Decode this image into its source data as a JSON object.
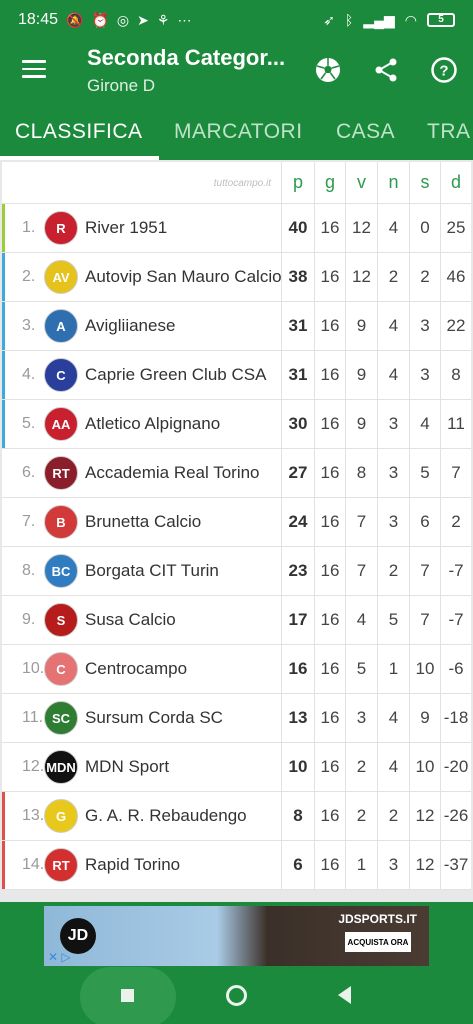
{
  "status_bar": {
    "time": "18:45",
    "battery": "5"
  },
  "app_bar": {
    "title": "Seconda Categor...",
    "subtitle": "Girone D"
  },
  "tabs": [
    {
      "label": "CLASSIFICA",
      "active": true
    },
    {
      "label": "MARCATORI",
      "active": false
    },
    {
      "label": "CASA",
      "active": false
    },
    {
      "label": "TRA",
      "active": false
    }
  ],
  "table": {
    "brand": "tuttocampo.it",
    "columns": [
      "p",
      "g",
      "v",
      "n",
      "s",
      "d"
    ],
    "rows": [
      {
        "pos": "1.",
        "team": "River 1951",
        "p": "40",
        "g": "16",
        "v": "12",
        "n": "4",
        "s": "0",
        "d": "25",
        "zone": "#9bcc3a",
        "logo_color": "#c8202f",
        "logo_text": "R"
      },
      {
        "pos": "2.",
        "team": "Autovip San Mauro Calcio",
        "p": "38",
        "g": "16",
        "v": "12",
        "n": "2",
        "s": "2",
        "d": "46",
        "zone": "#3fa8dc",
        "logo_color": "#e6c21c",
        "logo_text": "AV"
      },
      {
        "pos": "3.",
        "team": "Avigliianese",
        "p": "31",
        "g": "16",
        "v": "9",
        "n": "4",
        "s": "3",
        "d": "22",
        "zone": "#3fa8dc",
        "logo_color": "#2f6fb0",
        "logo_text": "A"
      },
      {
        "pos": "4.",
        "team": "Caprie Green Club CSA",
        "p": "31",
        "g": "16",
        "v": "9",
        "n": "4",
        "s": "3",
        "d": "8",
        "zone": "#3fa8dc",
        "logo_color": "#2a3f9c",
        "logo_text": "C"
      },
      {
        "pos": "5.",
        "team": "Atletico Alpignano",
        "p": "30",
        "g": "16",
        "v": "9",
        "n": "3",
        "s": "4",
        "d": "11",
        "zone": "#3fa8dc",
        "logo_color": "#c8202f",
        "logo_text": "AA"
      },
      {
        "pos": "6.",
        "team": "Accademia Real Torino",
        "p": "27",
        "g": "16",
        "v": "8",
        "n": "3",
        "s": "5",
        "d": "7",
        "zone": "",
        "logo_color": "#8b1e2b",
        "logo_text": "RT"
      },
      {
        "pos": "7.",
        "team": "Brunetta Calcio",
        "p": "24",
        "g": "16",
        "v": "7",
        "n": "3",
        "s": "6",
        "d": "2",
        "zone": "",
        "logo_color": "#d23a3a",
        "logo_text": "B"
      },
      {
        "pos": "8.",
        "team": "Borgata CIT Turin",
        "p": "23",
        "g": "16",
        "v": "7",
        "n": "2",
        "s": "7",
        "d": "-7",
        "zone": "",
        "logo_color": "#2f7cc1",
        "logo_text": "BC"
      },
      {
        "pos": "9.",
        "team": "Susa Calcio",
        "p": "17",
        "g": "16",
        "v": "4",
        "n": "5",
        "s": "7",
        "d": "-7",
        "zone": "",
        "logo_color": "#b71c1c",
        "logo_text": "S"
      },
      {
        "pos": "10.",
        "team": "Centrocampo",
        "p": "16",
        "g": "16",
        "v": "5",
        "n": "1",
        "s": "10",
        "d": "-6",
        "zone": "",
        "logo_color": "#e57373",
        "logo_text": "C"
      },
      {
        "pos": "11.",
        "team": "Sursum Corda SC",
        "p": "13",
        "g": "16",
        "v": "3",
        "n": "4",
        "s": "9",
        "d": "-18",
        "zone": "",
        "logo_color": "#2e7d32",
        "logo_text": "SC"
      },
      {
        "pos": "12.",
        "team": "MDN Sport",
        "p": "10",
        "g": "16",
        "v": "2",
        "n": "4",
        "s": "10",
        "d": "-20",
        "zone": "",
        "logo_color": "#111111",
        "logo_text": "MDN"
      },
      {
        "pos": "13.",
        "team": "G. A. R. Rebaudengo",
        "p": "8",
        "g": "16",
        "v": "2",
        "n": "2",
        "s": "12",
        "d": "-26",
        "zone": "#e0504a",
        "logo_color": "#e8c81a",
        "logo_text": "G"
      },
      {
        "pos": "14.",
        "team": "Rapid Torino",
        "p": "6",
        "g": "16",
        "v": "1",
        "n": "3",
        "s": "12",
        "d": "-37",
        "zone": "#e0504a",
        "logo_color": "#d32f2f",
        "logo_text": "RT"
      }
    ]
  },
  "ad": {
    "logo": "JD",
    "site": "JDSPORTS.IT",
    "cta": "ACQUISTA ORA"
  },
  "colors": {
    "primary": "#1b8a3c",
    "header_text": "#2e9b4f"
  }
}
